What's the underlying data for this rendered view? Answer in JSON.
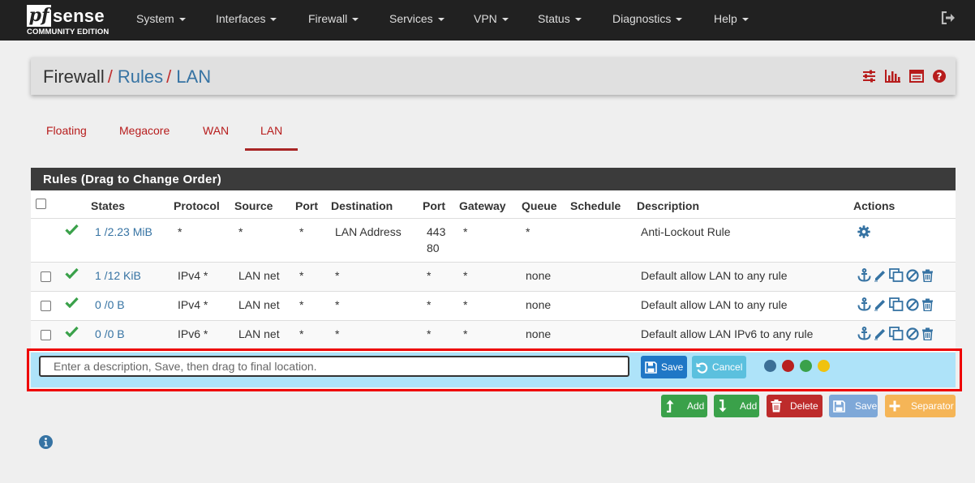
{
  "brand": {
    "pf": "pf",
    "sense": "sense",
    "edition": "COMMUNITY EDITION"
  },
  "nav": {
    "items": [
      "System",
      "Interfaces",
      "Firewall",
      "Services",
      "VPN",
      "Status",
      "Diagnostics",
      "Help"
    ],
    "logout_icon": "sign-out-icon"
  },
  "breadcrumb": {
    "section": "Firewall",
    "sep": "/",
    "page": "Rules",
    "sub": "LAN"
  },
  "header_icons": [
    "sliders-icon",
    "bar-chart-icon",
    "list-table-icon",
    "question-circle-icon"
  ],
  "tabs": {
    "items": [
      "Floating",
      "Megacore",
      "WAN",
      "LAN"
    ],
    "active": "LAN"
  },
  "rules_panel": {
    "title": "Rules (Drag to Change Order)",
    "columns": [
      "States",
      "Protocol",
      "Source",
      "Port",
      "Destination",
      "Port",
      "Gateway",
      "Queue",
      "Schedule",
      "Description",
      "Actions"
    ],
    "rows": [
      {
        "states": "1 /2.23 MiB",
        "protocol": "*",
        "source": "*",
        "port": "*",
        "destination": "LAN Address",
        "dport": "443",
        "dport2": "80",
        "gateway": "*",
        "queue": "*",
        "schedule": "",
        "description": "Anti-Lockout Rule",
        "checkbox": false,
        "action_icons": [
          "gear-icon"
        ]
      },
      {
        "states": "1 /12 KiB",
        "protocol": "IPv4 *",
        "source": "LAN net",
        "port": "*",
        "destination": "*",
        "dport": "*",
        "gateway": "*",
        "queue": "none",
        "schedule": "",
        "description": "Default allow LAN to any rule",
        "checkbox": true,
        "action_icons": [
          "anchor-icon",
          "pencil-icon",
          "copy-icon",
          "ban-icon",
          "trash-icon"
        ]
      },
      {
        "states": "0 /0 B",
        "protocol": "IPv4 *",
        "source": "LAN net",
        "port": "*",
        "destination": "*",
        "dport": "*",
        "gateway": "*",
        "queue": "none",
        "schedule": "",
        "description": "Default allow LAN to any rule",
        "checkbox": true,
        "action_icons": [
          "anchor-icon",
          "pencil-icon",
          "copy-icon",
          "ban-icon",
          "trash-icon"
        ]
      },
      {
        "states": "0 /0 B",
        "protocol": "IPv6 *",
        "source": "LAN net",
        "port": "*",
        "destination": "*",
        "dport": "*",
        "gateway": "*",
        "queue": "none",
        "schedule": "",
        "description": "Default allow LAN IPv6 to any rule",
        "checkbox": true,
        "action_icons": [
          "anchor-icon",
          "pencil-icon",
          "copy-icon",
          "ban-icon",
          "trash-icon"
        ]
      }
    ]
  },
  "separator_edit": {
    "placeholder": "Enter a description, Save, then drag to final location.",
    "value": "",
    "save_label": "Save",
    "cancel_label": "Cancel",
    "colors": [
      "#3c6f96",
      "#b82020",
      "#3aa14a",
      "#f0c20e"
    ]
  },
  "bottom_buttons": {
    "add_top": "Add",
    "add_bottom": "Add",
    "delete": "Delete",
    "save": "Save",
    "separator": "Separator"
  },
  "colors": {
    "navbar": "#212121",
    "accent_red": "#b71c1c",
    "link_blue": "#3673a3",
    "success": "#3aa14a",
    "danger": "#bd2b2b",
    "primary": "#1f77c6",
    "info": "#5bc0de",
    "warning": "#f0ad4e",
    "separator_bg": "#aee3f9"
  }
}
